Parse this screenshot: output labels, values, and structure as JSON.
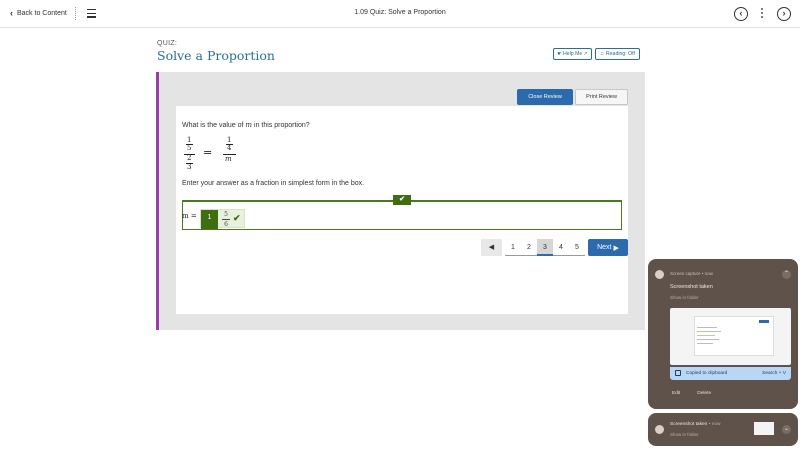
{
  "topbar": {
    "back_label": "Back to Content",
    "title": "1.09 Quiz: Solve a Proportion",
    "prev_icon": "chevron-left-icon",
    "next_icon": "chevron-right-icon"
  },
  "header": {
    "kicker": "QUIZ:",
    "title": "Solve a Proportion",
    "help_label": "Help Me",
    "reading_label": "Reading: Off"
  },
  "review": {
    "close_label": "Close Review",
    "print_label": "Print Review"
  },
  "question": {
    "text_before": "What is the value of ",
    "variable": "m",
    "text_after": " in this proportion?",
    "equation": {
      "left_num_num": "1",
      "left_num_den": "5",
      "left_den": "2",
      "left_den2": "3",
      "equals": "=",
      "right_num_num": "1",
      "right_num_den": "4",
      "right_den": "m"
    },
    "instruction": "Enter your answer as a fraction in simplest form in the box."
  },
  "answer": {
    "label": "m =",
    "index": "1",
    "frac_num": "5",
    "frac_den": "6",
    "status": "correct",
    "check_icon": "check-icon"
  },
  "pager": {
    "prev_icon": "triangle-left-icon",
    "pages": [
      "1",
      "2",
      "3",
      "4",
      "5"
    ],
    "current": "3",
    "next_label": "Next"
  },
  "notification": {
    "app_line": "Screen capture • now",
    "title": "Screenshot taken",
    "subtitle": "Show in folder",
    "copied_label": "Copied to clipboard",
    "shortcut": "Search + V",
    "edit_label": "Edit",
    "delete_label": "Delete"
  },
  "notification2": {
    "title": "Screenshot taken",
    "time": "• now",
    "subtitle": "Show in folder"
  },
  "colors": {
    "accent_blue": "#2a6aad",
    "title_teal": "#2a6f8f",
    "correct_green": "#3f6d12",
    "panel_purple": "#9b3ca8"
  }
}
